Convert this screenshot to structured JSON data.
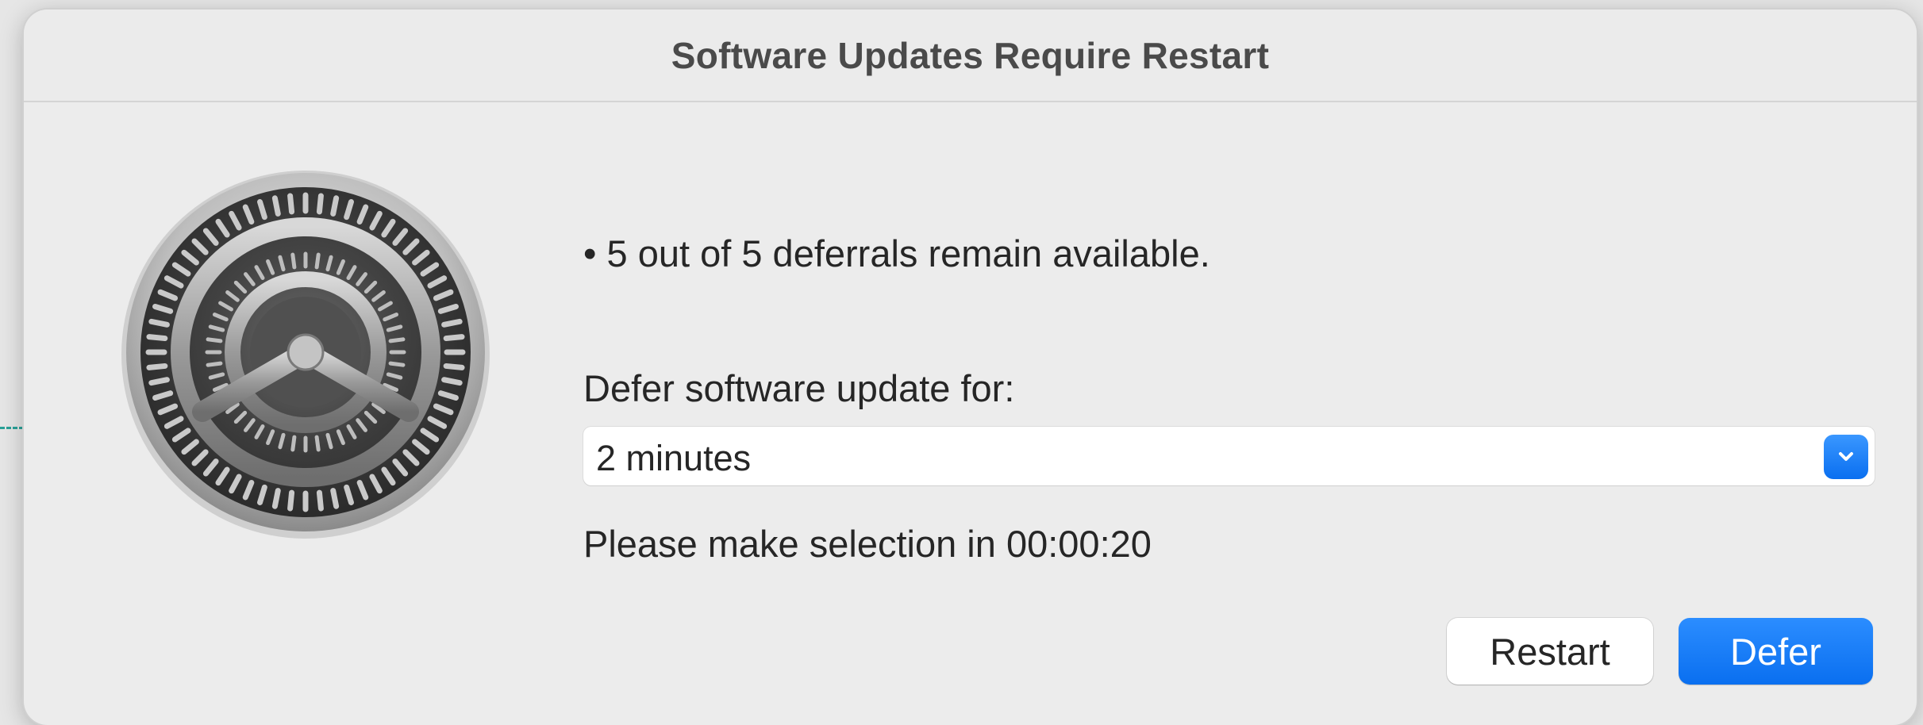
{
  "dialog": {
    "title": "Software Updates Require Restart",
    "icon": "system-preferences-gear-icon",
    "deferrals_text": "• 5 out of 5 deferrals remain available.",
    "defer_label": "Defer software update for:",
    "defer_select": {
      "selected": "2 minutes"
    },
    "countdown_text": "Please make selection in 00:00:20",
    "buttons": {
      "restart": "Restart",
      "defer": "Defer"
    }
  },
  "colors": {
    "accent": "#0a6ff0",
    "window_bg": "#ececec",
    "text": "#262626"
  }
}
